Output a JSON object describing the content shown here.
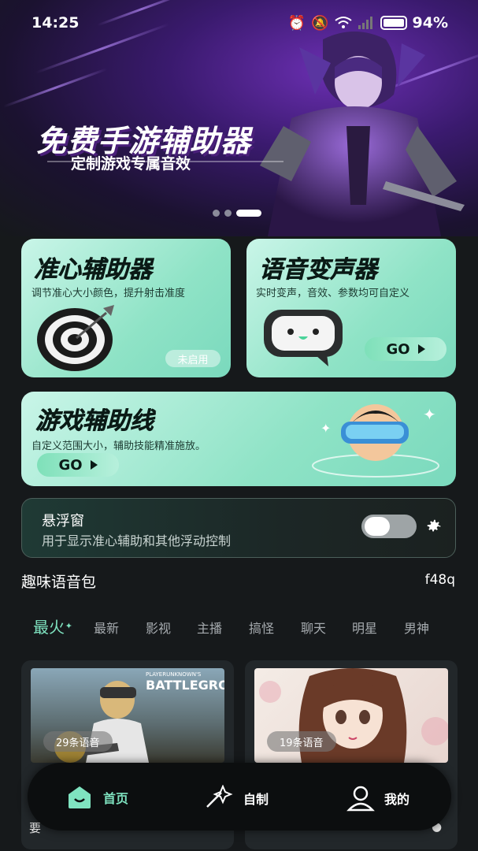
{
  "status": {
    "time": "14:25",
    "battery": "94%"
  },
  "banner": {
    "title": "免费手游辅助器",
    "subtitle": "定制游戏专属音效",
    "slides": 3,
    "active_slide": 3
  },
  "cards": {
    "crosshair": {
      "title": "准心辅助器",
      "desc": "调节准心大小颜色，提升射击准度",
      "status": "未启用"
    },
    "voice": {
      "title": "语音变声器",
      "desc": "实时变声，音效、参数均可自定义",
      "go": "GO"
    },
    "line": {
      "title": "游戏辅助线",
      "desc": "自定义范围大小，辅助技能精准施放。",
      "go": "GO"
    }
  },
  "float_window": {
    "title": "悬浮窗",
    "desc": "用于显示准心辅助和其他浮动控制",
    "enabled": false
  },
  "section": {
    "title": "趣味语音包",
    "more": "f48q"
  },
  "tabs": [
    "最火",
    "最新",
    "影视",
    "主播",
    "搞怪",
    "聊天",
    "明星",
    "男神"
  ],
  "packs": [
    {
      "count": "29条语音",
      "brand": "PLAYERUNKNOWN'S",
      "game": "BATTLEGROUNDS"
    },
    {
      "count": "19条语音"
    }
  ],
  "nav": {
    "home": "首页",
    "custom": "自制",
    "mine": "我的"
  }
}
